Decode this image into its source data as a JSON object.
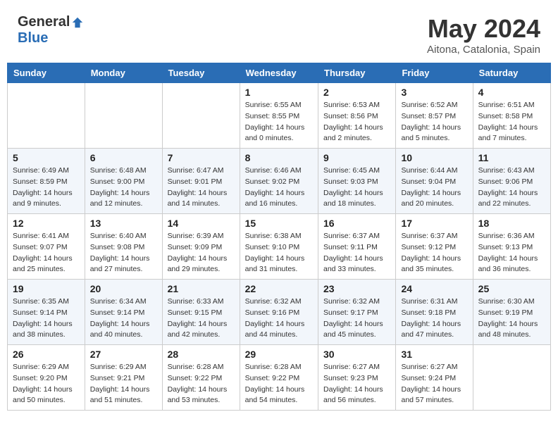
{
  "logo": {
    "general": "General",
    "blue": "Blue"
  },
  "header": {
    "month": "May 2024",
    "location": "Aitona, Catalonia, Spain"
  },
  "weekdays": [
    "Sunday",
    "Monday",
    "Tuesday",
    "Wednesday",
    "Thursday",
    "Friday",
    "Saturday"
  ],
  "weeks": [
    [
      {
        "day": "",
        "info": ""
      },
      {
        "day": "",
        "info": ""
      },
      {
        "day": "",
        "info": ""
      },
      {
        "day": "1",
        "sunrise": "6:55 AM",
        "sunset": "8:55 PM",
        "daylight": "14 hours and 0 minutes."
      },
      {
        "day": "2",
        "sunrise": "6:53 AM",
        "sunset": "8:56 PM",
        "daylight": "14 hours and 2 minutes."
      },
      {
        "day": "3",
        "sunrise": "6:52 AM",
        "sunset": "8:57 PM",
        "daylight": "14 hours and 5 minutes."
      },
      {
        "day": "4",
        "sunrise": "6:51 AM",
        "sunset": "8:58 PM",
        "daylight": "14 hours and 7 minutes."
      }
    ],
    [
      {
        "day": "5",
        "sunrise": "6:49 AM",
        "sunset": "8:59 PM",
        "daylight": "14 hours and 9 minutes."
      },
      {
        "day": "6",
        "sunrise": "6:48 AM",
        "sunset": "9:00 PM",
        "daylight": "14 hours and 12 minutes."
      },
      {
        "day": "7",
        "sunrise": "6:47 AM",
        "sunset": "9:01 PM",
        "daylight": "14 hours and 14 minutes."
      },
      {
        "day": "8",
        "sunrise": "6:46 AM",
        "sunset": "9:02 PM",
        "daylight": "14 hours and 16 minutes."
      },
      {
        "day": "9",
        "sunrise": "6:45 AM",
        "sunset": "9:03 PM",
        "daylight": "14 hours and 18 minutes."
      },
      {
        "day": "10",
        "sunrise": "6:44 AM",
        "sunset": "9:04 PM",
        "daylight": "14 hours and 20 minutes."
      },
      {
        "day": "11",
        "sunrise": "6:43 AM",
        "sunset": "9:06 PM",
        "daylight": "14 hours and 22 minutes."
      }
    ],
    [
      {
        "day": "12",
        "sunrise": "6:41 AM",
        "sunset": "9:07 PM",
        "daylight": "14 hours and 25 minutes."
      },
      {
        "day": "13",
        "sunrise": "6:40 AM",
        "sunset": "9:08 PM",
        "daylight": "14 hours and 27 minutes."
      },
      {
        "day": "14",
        "sunrise": "6:39 AM",
        "sunset": "9:09 PM",
        "daylight": "14 hours and 29 minutes."
      },
      {
        "day": "15",
        "sunrise": "6:38 AM",
        "sunset": "9:10 PM",
        "daylight": "14 hours and 31 minutes."
      },
      {
        "day": "16",
        "sunrise": "6:37 AM",
        "sunset": "9:11 PM",
        "daylight": "14 hours and 33 minutes."
      },
      {
        "day": "17",
        "sunrise": "6:37 AM",
        "sunset": "9:12 PM",
        "daylight": "14 hours and 35 minutes."
      },
      {
        "day": "18",
        "sunrise": "6:36 AM",
        "sunset": "9:13 PM",
        "daylight": "14 hours and 36 minutes."
      }
    ],
    [
      {
        "day": "19",
        "sunrise": "6:35 AM",
        "sunset": "9:14 PM",
        "daylight": "14 hours and 38 minutes."
      },
      {
        "day": "20",
        "sunrise": "6:34 AM",
        "sunset": "9:14 PM",
        "daylight": "14 hours and 40 minutes."
      },
      {
        "day": "21",
        "sunrise": "6:33 AM",
        "sunset": "9:15 PM",
        "daylight": "14 hours and 42 minutes."
      },
      {
        "day": "22",
        "sunrise": "6:32 AM",
        "sunset": "9:16 PM",
        "daylight": "14 hours and 44 minutes."
      },
      {
        "day": "23",
        "sunrise": "6:32 AM",
        "sunset": "9:17 PM",
        "daylight": "14 hours and 45 minutes."
      },
      {
        "day": "24",
        "sunrise": "6:31 AM",
        "sunset": "9:18 PM",
        "daylight": "14 hours and 47 minutes."
      },
      {
        "day": "25",
        "sunrise": "6:30 AM",
        "sunset": "9:19 PM",
        "daylight": "14 hours and 48 minutes."
      }
    ],
    [
      {
        "day": "26",
        "sunrise": "6:29 AM",
        "sunset": "9:20 PM",
        "daylight": "14 hours and 50 minutes."
      },
      {
        "day": "27",
        "sunrise": "6:29 AM",
        "sunset": "9:21 PM",
        "daylight": "14 hours and 51 minutes."
      },
      {
        "day": "28",
        "sunrise": "6:28 AM",
        "sunset": "9:22 PM",
        "daylight": "14 hours and 53 minutes."
      },
      {
        "day": "29",
        "sunrise": "6:28 AM",
        "sunset": "9:22 PM",
        "daylight": "14 hours and 54 minutes."
      },
      {
        "day": "30",
        "sunrise": "6:27 AM",
        "sunset": "9:23 PM",
        "daylight": "14 hours and 56 minutes."
      },
      {
        "day": "31",
        "sunrise": "6:27 AM",
        "sunset": "9:24 PM",
        "daylight": "14 hours and 57 minutes."
      },
      {
        "day": "",
        "info": ""
      }
    ]
  ]
}
